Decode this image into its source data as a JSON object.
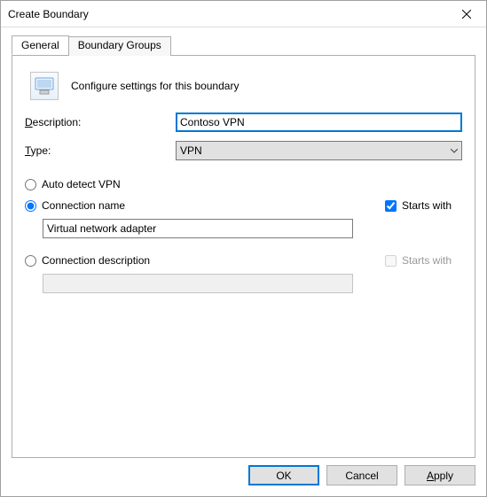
{
  "window": {
    "title": "Create Boundary"
  },
  "tabs": {
    "general": "General",
    "groups": "Boundary Groups"
  },
  "panel": {
    "subtitle": "Configure settings for this boundary",
    "description_label_pre": "",
    "description_label_ul": "D",
    "description_label_post": "escription:",
    "description_value": "Contoso VPN",
    "type_label_pre": "",
    "type_label_ul": "T",
    "type_label_post": "ype:",
    "type_value": "VPN"
  },
  "vpn": {
    "auto_label": "Auto detect VPN",
    "connection_name_label": "Connection name",
    "connection_desc_label": "Connection description",
    "starts_with_label": "Starts with",
    "name_value": "Virtual network adapter",
    "desc_value": ""
  },
  "buttons": {
    "ok": "OK",
    "cancel": "Cancel",
    "apply_ul": "A",
    "apply_post": "pply"
  }
}
